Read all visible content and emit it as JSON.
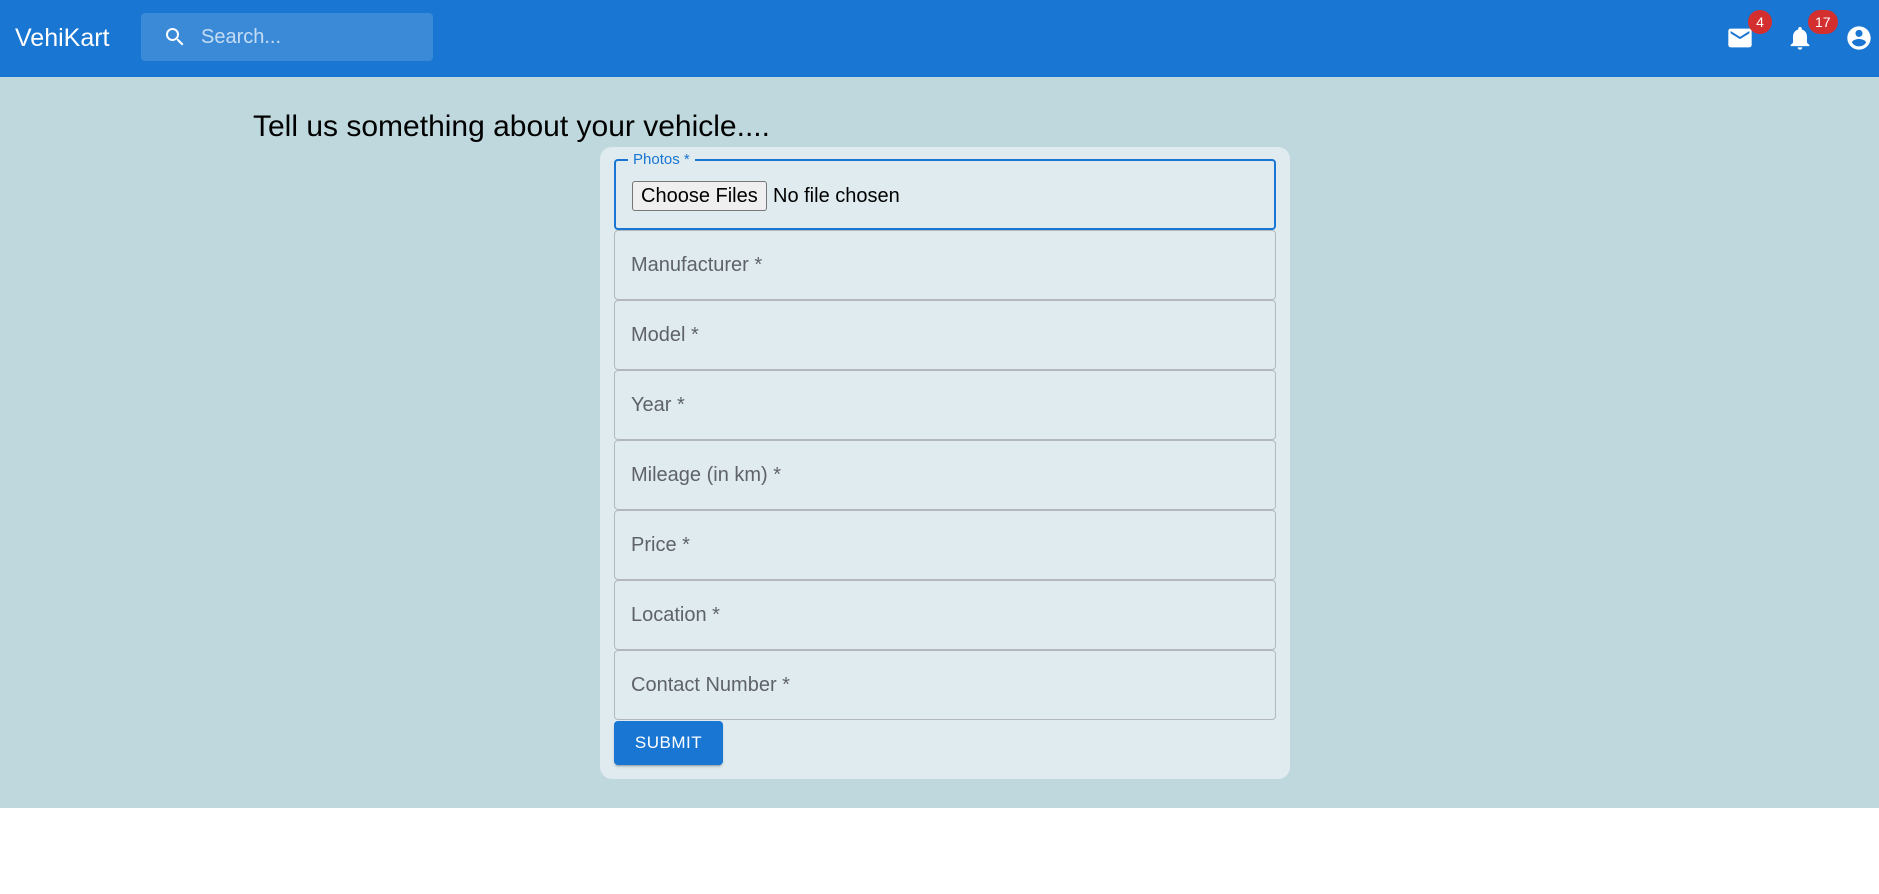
{
  "appbar": {
    "brand": "VehiKart",
    "search": {
      "placeholder": "Search...",
      "icon": "search-icon"
    },
    "mail": {
      "icon": "mail-icon",
      "badge": "4"
    },
    "notifications": {
      "icon": "bell-icon",
      "badge": "17"
    },
    "account": {
      "icon": "account-circle-icon"
    },
    "color": "#1976d2"
  },
  "main": {
    "heading": "Tell us something about your vehicle....",
    "background": "#bed8de"
  },
  "form": {
    "photos": {
      "label": "Photos *",
      "button": "Choose Files",
      "status": "No file chosen"
    },
    "fields": [
      {
        "label": "Manufacturer *"
      },
      {
        "label": "Model *"
      },
      {
        "label": "Year *"
      },
      {
        "label": "Mileage (in km) *"
      },
      {
        "label": "Price *"
      },
      {
        "label": "Location *"
      },
      {
        "label": "Contact Number *"
      }
    ],
    "submit": "SUBMIT"
  }
}
